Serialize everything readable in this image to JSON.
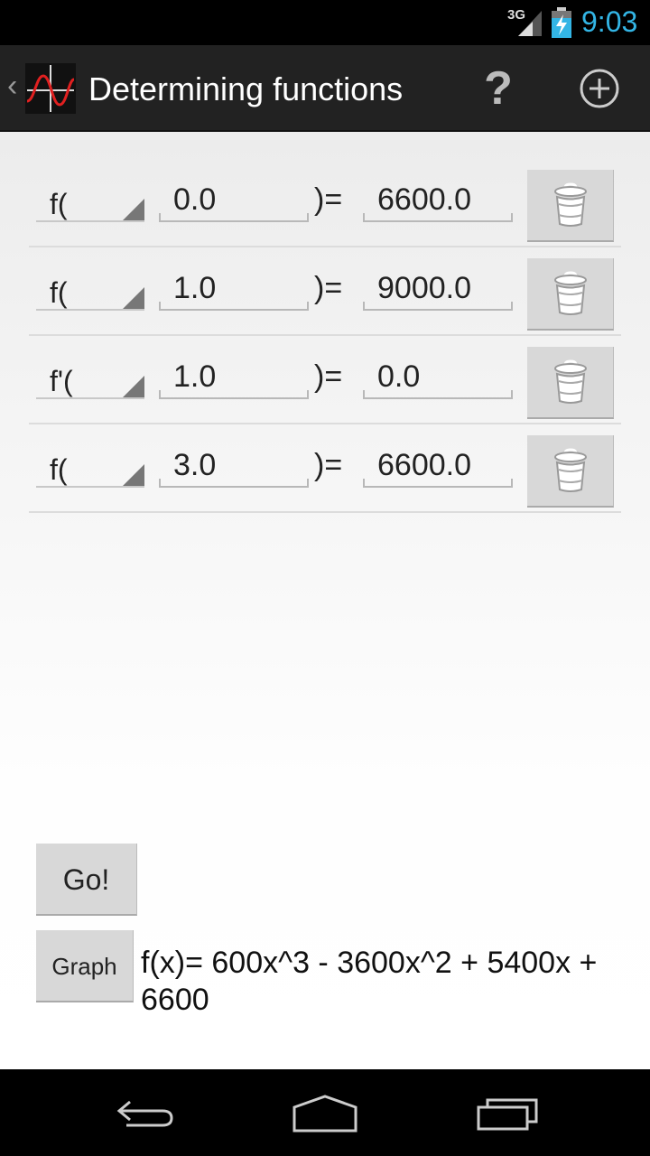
{
  "status_bar": {
    "network": "3G",
    "time": "9:03"
  },
  "action_bar": {
    "title": "Determining functions",
    "help_label": "?",
    "app_icon": "sine-graph-icon",
    "add_icon": "add-circle-icon"
  },
  "rows": [
    {
      "func": "f(",
      "x": "0.0",
      "equals": ")=",
      "y": "6600.0"
    },
    {
      "func": "f(",
      "x": "1.0",
      "equals": ")=",
      "y": "9000.0"
    },
    {
      "func": "f'(",
      "x": "1.0",
      "equals": ")=",
      "y": "0.0"
    },
    {
      "func": "f(",
      "x": "3.0",
      "equals": ")=",
      "y": "6600.0"
    }
  ],
  "actions": {
    "go_label": "Go!",
    "graph_label": "Graph"
  },
  "result": {
    "text": "f(x)= 600x^3 - 3600x^2 + 5400x + 6600"
  },
  "colors": {
    "accent": "#33b5e5",
    "action_bar_bg": "#222222",
    "button_bg": "#d8d8d8",
    "graph_curve": "#e02020"
  }
}
